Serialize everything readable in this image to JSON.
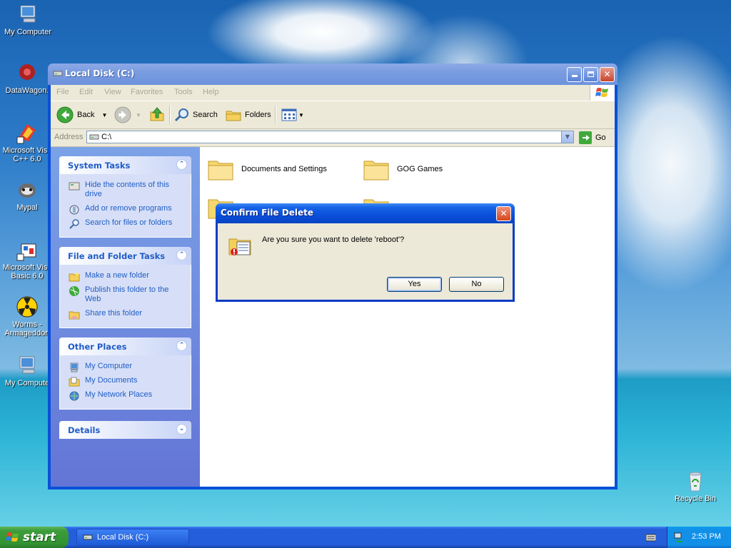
{
  "desktop": {
    "icons": [
      {
        "label": "My Computer",
        "icon": "my-computer-icon"
      },
      {
        "label": "DataWagon.",
        "icon": "datawagon-icon"
      },
      {
        "label": "Microsoft Visu C++ 6.0",
        "icon": "visual-cpp-icon"
      },
      {
        "label": "Mypal",
        "icon": "mypal-icon"
      },
      {
        "label": "Microsoft Visu Basic 6.0",
        "icon": "visual-basic-icon"
      },
      {
        "label": "Worms - Armageddon",
        "icon": "worms-icon"
      },
      {
        "label": "My Compute",
        "icon": "my-computer-shortcut-icon"
      },
      {
        "label": "Recycle Bin",
        "icon": "recycle-bin-icon"
      }
    ]
  },
  "window": {
    "title": "Local Disk (C:)",
    "menu": [
      "File",
      "Edit",
      "View",
      "Favorites",
      "Tools",
      "Help"
    ],
    "toolbar": {
      "back": "Back",
      "search": "Search",
      "folders": "Folders"
    },
    "address": {
      "label": "Address",
      "value": "C:\\",
      "go": "Go"
    },
    "taskpane": {
      "system_tasks": {
        "title": "System Tasks",
        "items": [
          "Hide the contents of this drive",
          "Add or remove programs",
          "Search for files or folders"
        ]
      },
      "file_folder_tasks": {
        "title": "File and Folder Tasks",
        "items": [
          "Make a new folder",
          "Publish this folder to the Web",
          "Share this folder"
        ]
      },
      "other_places": {
        "title": "Other Places",
        "items": [
          "My Computer",
          "My Documents",
          "My Network Places"
        ]
      },
      "details": {
        "title": "Details"
      }
    },
    "folders": [
      "Documents and Settings",
      "GOG Games"
    ]
  },
  "dialog": {
    "title": "Confirm File Delete",
    "message": "Are you sure you want to delete 'reboot'?",
    "yes": "Yes",
    "no": "No"
  },
  "taskbar": {
    "start": "start",
    "task": "Local Disk (C:)",
    "clock": "2:53 PM"
  },
  "colors": {
    "xp_blue": "#0a50d8",
    "task_link": "#215dc6",
    "start_green": "#3c9c3a"
  }
}
